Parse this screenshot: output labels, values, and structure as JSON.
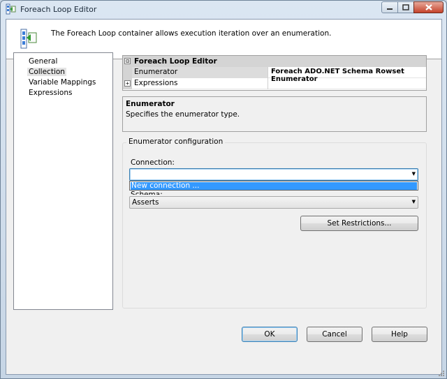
{
  "window": {
    "title": "Foreach Loop Editor",
    "icon": "foreach-loop-icon"
  },
  "header": {
    "description": "The Foreach Loop container allows execution iteration over an enumeration.",
    "icon": "foreach-container-icon"
  },
  "nav": {
    "items": [
      {
        "label": "General",
        "selected": false
      },
      {
        "label": "Collection",
        "selected": true
      },
      {
        "label": "Variable Mappings",
        "selected": false
      },
      {
        "label": "Expressions",
        "selected": false
      }
    ]
  },
  "property_grid": {
    "category": "Foreach Loop Editor",
    "category_expander": "⊟",
    "rows": [
      {
        "name": "Enumerator",
        "value": "Foreach ADO.NET Schema Rowset Enumerator"
      },
      {
        "name": "Expressions",
        "value": "",
        "expander": "+"
      }
    ]
  },
  "help_panel": {
    "title": "Enumerator",
    "description": "Specifies the enumerator type."
  },
  "enumerator_config": {
    "group_title": "Enumerator configuration",
    "connection_label": "Connection:",
    "connection_value": "",
    "dropdown_options": [
      "New connection ..."
    ],
    "schema_label": "Schema:",
    "schema_value": "Asserts",
    "set_restrictions_label": "Set Restrictions..."
  },
  "buttons": {
    "ok": "OK",
    "cancel": "Cancel",
    "help": "Help"
  },
  "colors": {
    "selection": "#3399ff",
    "close_button": "#c5432b",
    "focus_border": "#3c7fb1"
  }
}
